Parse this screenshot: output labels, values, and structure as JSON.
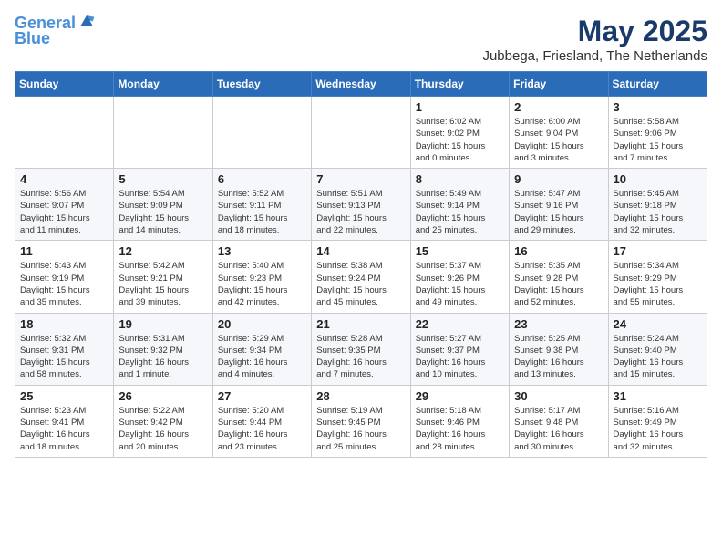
{
  "header": {
    "logo_line1": "General",
    "logo_line2": "Blue",
    "month": "May 2025",
    "location": "Jubbega, Friesland, The Netherlands"
  },
  "weekdays": [
    "Sunday",
    "Monday",
    "Tuesday",
    "Wednesday",
    "Thursday",
    "Friday",
    "Saturday"
  ],
  "weeks": [
    [
      {
        "day": "",
        "info": ""
      },
      {
        "day": "",
        "info": ""
      },
      {
        "day": "",
        "info": ""
      },
      {
        "day": "",
        "info": ""
      },
      {
        "day": "1",
        "info": "Sunrise: 6:02 AM\nSunset: 9:02 PM\nDaylight: 15 hours\nand 0 minutes."
      },
      {
        "day": "2",
        "info": "Sunrise: 6:00 AM\nSunset: 9:04 PM\nDaylight: 15 hours\nand 3 minutes."
      },
      {
        "day": "3",
        "info": "Sunrise: 5:58 AM\nSunset: 9:06 PM\nDaylight: 15 hours\nand 7 minutes."
      }
    ],
    [
      {
        "day": "4",
        "info": "Sunrise: 5:56 AM\nSunset: 9:07 PM\nDaylight: 15 hours\nand 11 minutes."
      },
      {
        "day": "5",
        "info": "Sunrise: 5:54 AM\nSunset: 9:09 PM\nDaylight: 15 hours\nand 14 minutes."
      },
      {
        "day": "6",
        "info": "Sunrise: 5:52 AM\nSunset: 9:11 PM\nDaylight: 15 hours\nand 18 minutes."
      },
      {
        "day": "7",
        "info": "Sunrise: 5:51 AM\nSunset: 9:13 PM\nDaylight: 15 hours\nand 22 minutes."
      },
      {
        "day": "8",
        "info": "Sunrise: 5:49 AM\nSunset: 9:14 PM\nDaylight: 15 hours\nand 25 minutes."
      },
      {
        "day": "9",
        "info": "Sunrise: 5:47 AM\nSunset: 9:16 PM\nDaylight: 15 hours\nand 29 minutes."
      },
      {
        "day": "10",
        "info": "Sunrise: 5:45 AM\nSunset: 9:18 PM\nDaylight: 15 hours\nand 32 minutes."
      }
    ],
    [
      {
        "day": "11",
        "info": "Sunrise: 5:43 AM\nSunset: 9:19 PM\nDaylight: 15 hours\nand 35 minutes."
      },
      {
        "day": "12",
        "info": "Sunrise: 5:42 AM\nSunset: 9:21 PM\nDaylight: 15 hours\nand 39 minutes."
      },
      {
        "day": "13",
        "info": "Sunrise: 5:40 AM\nSunset: 9:23 PM\nDaylight: 15 hours\nand 42 minutes."
      },
      {
        "day": "14",
        "info": "Sunrise: 5:38 AM\nSunset: 9:24 PM\nDaylight: 15 hours\nand 45 minutes."
      },
      {
        "day": "15",
        "info": "Sunrise: 5:37 AM\nSunset: 9:26 PM\nDaylight: 15 hours\nand 49 minutes."
      },
      {
        "day": "16",
        "info": "Sunrise: 5:35 AM\nSunset: 9:28 PM\nDaylight: 15 hours\nand 52 minutes."
      },
      {
        "day": "17",
        "info": "Sunrise: 5:34 AM\nSunset: 9:29 PM\nDaylight: 15 hours\nand 55 minutes."
      }
    ],
    [
      {
        "day": "18",
        "info": "Sunrise: 5:32 AM\nSunset: 9:31 PM\nDaylight: 15 hours\nand 58 minutes."
      },
      {
        "day": "19",
        "info": "Sunrise: 5:31 AM\nSunset: 9:32 PM\nDaylight: 16 hours\nand 1 minute."
      },
      {
        "day": "20",
        "info": "Sunrise: 5:29 AM\nSunset: 9:34 PM\nDaylight: 16 hours\nand 4 minutes."
      },
      {
        "day": "21",
        "info": "Sunrise: 5:28 AM\nSunset: 9:35 PM\nDaylight: 16 hours\nand 7 minutes."
      },
      {
        "day": "22",
        "info": "Sunrise: 5:27 AM\nSunset: 9:37 PM\nDaylight: 16 hours\nand 10 minutes."
      },
      {
        "day": "23",
        "info": "Sunrise: 5:25 AM\nSunset: 9:38 PM\nDaylight: 16 hours\nand 13 minutes."
      },
      {
        "day": "24",
        "info": "Sunrise: 5:24 AM\nSunset: 9:40 PM\nDaylight: 16 hours\nand 15 minutes."
      }
    ],
    [
      {
        "day": "25",
        "info": "Sunrise: 5:23 AM\nSunset: 9:41 PM\nDaylight: 16 hours\nand 18 minutes."
      },
      {
        "day": "26",
        "info": "Sunrise: 5:22 AM\nSunset: 9:42 PM\nDaylight: 16 hours\nand 20 minutes."
      },
      {
        "day": "27",
        "info": "Sunrise: 5:20 AM\nSunset: 9:44 PM\nDaylight: 16 hours\nand 23 minutes."
      },
      {
        "day": "28",
        "info": "Sunrise: 5:19 AM\nSunset: 9:45 PM\nDaylight: 16 hours\nand 25 minutes."
      },
      {
        "day": "29",
        "info": "Sunrise: 5:18 AM\nSunset: 9:46 PM\nDaylight: 16 hours\nand 28 minutes."
      },
      {
        "day": "30",
        "info": "Sunrise: 5:17 AM\nSunset: 9:48 PM\nDaylight: 16 hours\nand 30 minutes."
      },
      {
        "day": "31",
        "info": "Sunrise: 5:16 AM\nSunset: 9:49 PM\nDaylight: 16 hours\nand 32 minutes."
      }
    ]
  ]
}
